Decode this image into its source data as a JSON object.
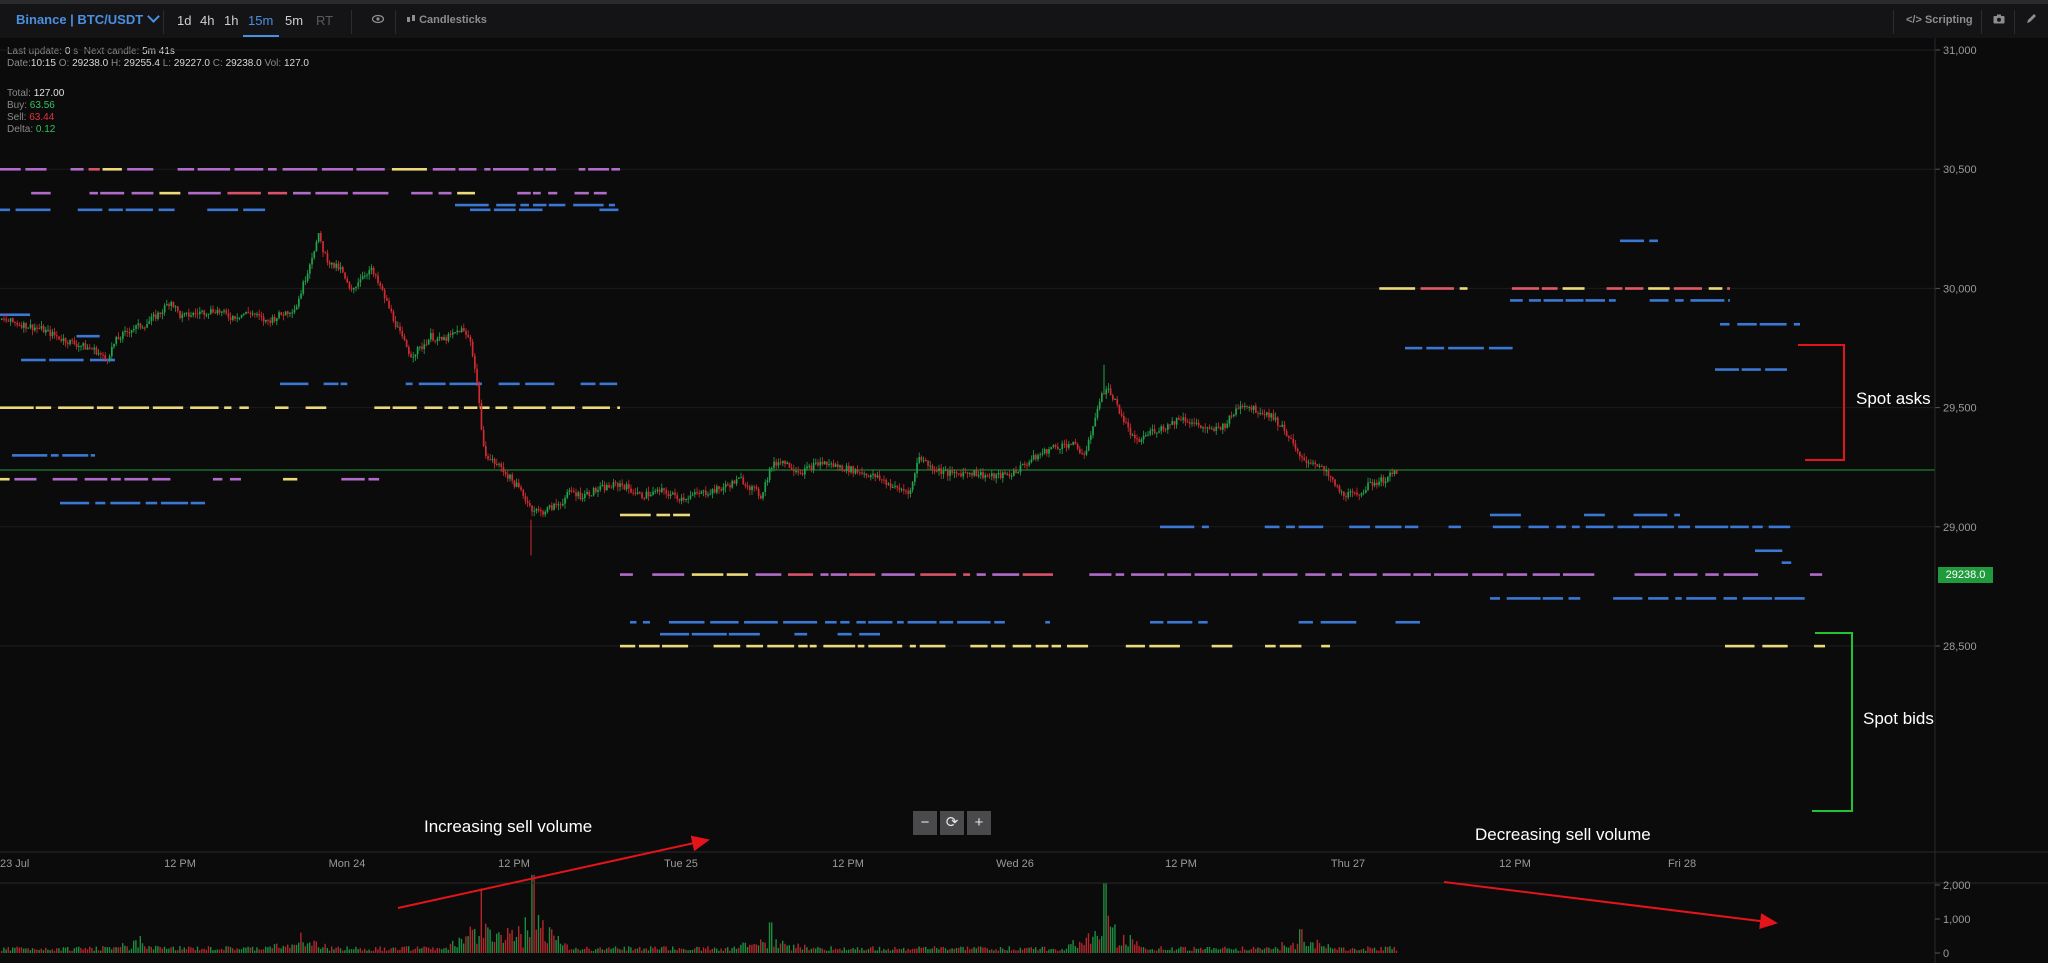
{
  "toolbar": {
    "market": "Binance | BTC/USDT",
    "timeframes": [
      "1d",
      "4h",
      "1h",
      "15m",
      "5m",
      "RT"
    ],
    "active_timeframe": "15m",
    "candlesticks": "Candlesticks",
    "scripting": "Scripting",
    "icons": [
      "eye-icon",
      "candlestick-icon",
      "code-icon",
      "camera-icon",
      "pencil-icon",
      "chevron-down-icon"
    ]
  },
  "info": {
    "last_update_label": "Last update:",
    "last_update_value": "0",
    "last_update_unit": "s",
    "next_candle_label": "Next candle:",
    "next_candle_value": "5m 41s",
    "date_label": "Date:",
    "date_value": "10:15",
    "o_label": "O:",
    "o_value": "29238.0",
    "h_label": "H:",
    "h_value": "29255.4",
    "l_label": "L:",
    "l_value": "29227.0",
    "c_label": "C:",
    "c_value": "29238.0",
    "vol_label": "Vol:",
    "vol_value": "127.0"
  },
  "stats": {
    "total_label": "Total:",
    "total_value": "127.00",
    "buy_label": "Buy:",
    "buy_value": "63.56",
    "sell_label": "Sell:",
    "sell_value": "63.44",
    "delta_label": "Delta:",
    "delta_value": "0.12"
  },
  "price_axis": {
    "ticks": [
      "31,000",
      "30,500",
      "30,000",
      "29,500",
      "29,000",
      "28,500"
    ],
    "current_price": "29238.0"
  },
  "volume_axis": {
    "ticks": [
      "2,000",
      "1,000",
      "0"
    ]
  },
  "time_axis": {
    "ticks": [
      "23 Jul",
      "12 PM",
      "Mon 24",
      "12 PM",
      "Tue 25",
      "12 PM",
      "Wed 26",
      "12 PM",
      "Thu 27",
      "12 PM",
      "Fri 28"
    ]
  },
  "annotations": {
    "spot_asks": "Spot asks",
    "spot_bids": "Spot bids",
    "increasing": "Increasing sell volume",
    "decreasing": "Decreasing sell volume"
  },
  "zoom": {
    "minus": "−",
    "reset": "⟳",
    "plus": "+"
  },
  "colors": {
    "background": "#0b0b0c",
    "up_candle": "#22a34a",
    "down_candle": "#d12b31",
    "bid_level": "#3a78d4",
    "large_level": "#ecd97a",
    "mixed_level": "#b16bc9",
    "current_price_line": "#1f9a3c",
    "annotation_red": "#e3141a",
    "annotation_green": "#22c232"
  },
  "chart_data": {
    "type": "candlestick",
    "ylim": [
      28350,
      31050
    ],
    "close_path": [
      [
        0,
        29870
      ],
      [
        20,
        29850
      ],
      [
        40,
        29830
      ],
      [
        60,
        29790
      ],
      [
        80,
        29760
      ],
      [
        95,
        29740
      ],
      [
        105,
        29700
      ],
      [
        115,
        29780
      ],
      [
        130,
        29830
      ],
      [
        145,
        29850
      ],
      [
        160,
        29900
      ],
      [
        170,
        29950
      ],
      [
        180,
        29880
      ],
      [
        200,
        29900
      ],
      [
        215,
        29910
      ],
      [
        230,
        29880
      ],
      [
        250,
        29900
      ],
      [
        265,
        29860
      ],
      [
        280,
        29890
      ],
      [
        295,
        29920
      ],
      [
        305,
        30050
      ],
      [
        312,
        30150
      ],
      [
        318,
        30220
      ],
      [
        323,
        30150
      ],
      [
        330,
        30100
      ],
      [
        340,
        30080
      ],
      [
        350,
        29980
      ],
      [
        360,
        30050
      ],
      [
        370,
        30080
      ],
      [
        380,
        30000
      ],
      [
        390,
        29900
      ],
      [
        400,
        29800
      ],
      [
        410,
        29720
      ],
      [
        420,
        29750
      ],
      [
        430,
        29800
      ],
      [
        440,
        29780
      ],
      [
        450,
        29800
      ],
      [
        460,
        29830
      ],
      [
        470,
        29780
      ],
      [
        478,
        29550
      ],
      [
        482,
        29330
      ],
      [
        490,
        29280
      ],
      [
        500,
        29250
      ],
      [
        510,
        29200
      ],
      [
        520,
        29150
      ],
      [
        530,
        29080
      ],
      [
        540,
        29060
      ],
      [
        550,
        29080
      ],
      [
        560,
        29100
      ],
      [
        570,
        29150
      ],
      [
        580,
        29130
      ],
      [
        600,
        29160
      ],
      [
        620,
        29180
      ],
      [
        640,
        29130
      ],
      [
        660,
        29150
      ],
      [
        680,
        29120
      ],
      [
        700,
        29140
      ],
      [
        720,
        29160
      ],
      [
        740,
        29200
      ],
      [
        760,
        29130
      ],
      [
        770,
        29250
      ],
      [
        780,
        29280
      ],
      [
        800,
        29230
      ],
      [
        820,
        29270
      ],
      [
        840,
        29250
      ],
      [
        860,
        29230
      ],
      [
        880,
        29200
      ],
      [
        895,
        29160
      ],
      [
        910,
        29150
      ],
      [
        918,
        29300
      ],
      [
        930,
        29250
      ],
      [
        950,
        29220
      ],
      [
        970,
        29230
      ],
      [
        990,
        29210
      ],
      [
        1010,
        29220
      ],
      [
        1030,
        29280
      ],
      [
        1050,
        29330
      ],
      [
        1070,
        29350
      ],
      [
        1085,
        29300
      ],
      [
        1095,
        29480
      ],
      [
        1105,
        29590
      ],
      [
        1115,
        29520
      ],
      [
        1125,
        29430
      ],
      [
        1135,
        29350
      ],
      [
        1150,
        29400
      ],
      [
        1165,
        29420
      ],
      [
        1180,
        29460
      ],
      [
        1195,
        29430
      ],
      [
        1210,
        29400
      ],
      [
        1225,
        29430
      ],
      [
        1240,
        29520
      ],
      [
        1255,
        29490
      ],
      [
        1270,
        29470
      ],
      [
        1285,
        29400
      ],
      [
        1300,
        29280
      ],
      [
        1315,
        29270
      ],
      [
        1330,
        29200
      ],
      [
        1340,
        29140
      ],
      [
        1355,
        29130
      ],
      [
        1370,
        29180
      ],
      [
        1385,
        29200
      ],
      [
        1398,
        29238
      ]
    ],
    "volume_peaks": [
      [
        480,
        1900
      ],
      [
        532,
        2300
      ],
      [
        1104,
        2050
      ],
      [
        770,
        900
      ],
      [
        140,
        500
      ],
      [
        300,
        600
      ],
      [
        1300,
        700
      ]
    ],
    "order_levels": [
      {
        "price": 29238,
        "kind": "current"
      },
      {
        "price": 30500,
        "kind": "mixed"
      },
      {
        "price": 30400,
        "kind": "mixed"
      },
      {
        "price": 30000,
        "kind": "large"
      },
      {
        "price": 29500,
        "kind": "large"
      },
      {
        "price": 29000,
        "kind": "bid"
      },
      {
        "price": 28800,
        "kind": "mixed"
      },
      {
        "price": 28500,
        "kind": "large"
      }
    ]
  }
}
